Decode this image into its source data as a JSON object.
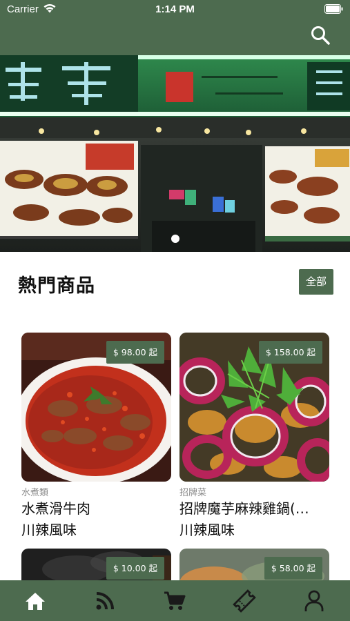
{
  "status_bar": {
    "carrier": "Carrier",
    "time": "1:14 PM",
    "wifi_icon": "wifi-icon",
    "battery_icon": "battery-icon"
  },
  "app_bar": {
    "search_icon": "search-icon",
    "color": "#4d6b4f"
  },
  "banner": {
    "slide_count": 1,
    "active_slide": 1
  },
  "hot_products": {
    "title": "熱門商品",
    "all_label": "全部"
  },
  "products": [
    {
      "price": "$ 98.00 起",
      "category": "水煮類",
      "name": "水煮滑牛肉",
      "tag": " 川辣風味"
    },
    {
      "price": "$ 158.00 起",
      "category": "招牌菜",
      "name": "招牌魔芋麻辣雞鍋(…",
      "tag": "川辣風味"
    },
    {
      "price": "$ 10.00 起"
    },
    {
      "price": "$ 58.00 起"
    }
  ],
  "tab_bar": {
    "tabs": [
      {
        "icon": "home-icon",
        "active": true
      },
      {
        "icon": "rss-feed-icon",
        "active": false
      },
      {
        "icon": "shopping-cart-icon",
        "active": false
      },
      {
        "icon": "ticket-icon",
        "active": false
      },
      {
        "icon": "user-icon",
        "active": false
      }
    ]
  }
}
